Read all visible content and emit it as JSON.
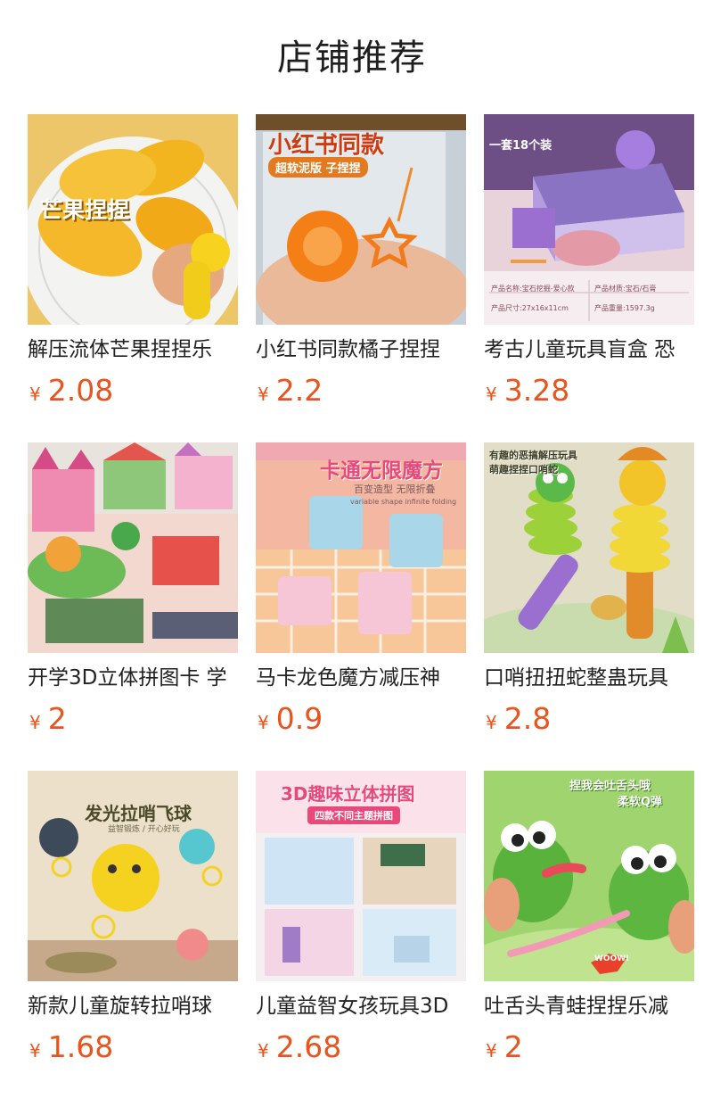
{
  "section": {
    "title": "店铺推荐"
  },
  "colors": {
    "price": "#e9531c",
    "text": "#222222",
    "background": "#ffffff"
  },
  "currency_symbol": "¥",
  "products": [
    {
      "title": "解压流体芒果捏捏乐",
      "price": "2.08",
      "image_caption": "芒果捏捏",
      "image_icon": "mango-squishy-toy"
    },
    {
      "title": "小红书同款橘子捏捏",
      "price": "2.2",
      "image_caption": "小红书同款",
      "image_caption2": "超软泥版 子捏捏",
      "image_icon": "orange-squishy-toy"
    },
    {
      "title": "考古儿童玩具盲盒 恐",
      "price": "3.28",
      "image_caption": "一套18个装",
      "image_caption2": "产品名称:宝石挖掘-爱心款",
      "image_caption3": "产品材质:宝石/石膏",
      "image_caption4": "产品尺寸:27x16x11cm",
      "image_caption5": "产品重量:1597.3g",
      "image_icon": "gem-dig-kit"
    },
    {
      "title": "开学3D立体拼图卡 学",
      "price": "2",
      "image_icon": "3d-puzzle-castle"
    },
    {
      "title": "马卡龙色魔方减压神",
      "price": "0.9",
      "image_caption": "卡通无限魔方",
      "image_caption2": "百变造型 无限折叠",
      "image_caption3": "variable shape infinite folding",
      "image_icon": "infinity-cube"
    },
    {
      "title": "口哨扭扭蛇整蛊玩具",
      "price": "2.8",
      "image_caption": "有趣的恶搞解压玩具",
      "image_caption2": "萌趣捏捏口哨蛇",
      "image_icon": "whistle-snake-toy"
    },
    {
      "title": "新款儿童旋转拉哨球",
      "price": "1.68",
      "image_caption": "发光拉哨飞球",
      "image_caption2": "益智锻炼 / 开心好玩",
      "image_icon": "whistle-ball-toy"
    },
    {
      "title": "儿童益智女孩玩具3D",
      "price": "2.68",
      "image_caption": "3D趣味立体拼图",
      "image_caption2": "四款不同主题拼图",
      "image_icon": "3d-puzzle-house"
    },
    {
      "title": "吐舌头青蛙捏捏乐减",
      "price": "2",
      "image_caption": "捏我会吐舌头哦",
      "image_caption2": "柔软Q弹",
      "image_caption3": "WOOW!",
      "image_icon": "frog-tongue-toy"
    }
  ]
}
